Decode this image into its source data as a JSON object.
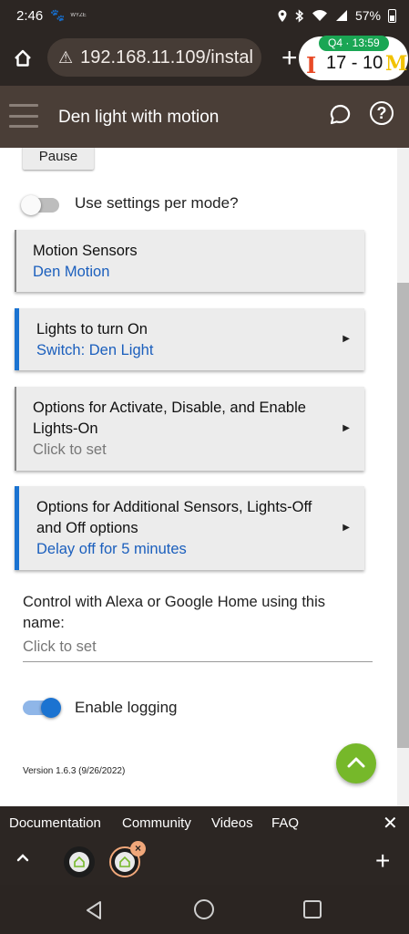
{
  "status_bar": {
    "time": "2:46",
    "paw_glyph": "🐾",
    "app_tag": "WYZE",
    "battery": "57%"
  },
  "browser": {
    "url": "192.168.11.109/instal",
    "warning_glyph": "⚠",
    "new_tab": "+"
  },
  "score": {
    "period": "Q4 · 13:59",
    "team_left": "I",
    "score_text": "17 - 10",
    "team_right": "M"
  },
  "header": {
    "title": "Den light with motion",
    "help_glyph": "?"
  },
  "content": {
    "pause_label": "Pause",
    "settings_per_mode": {
      "label": "Use settings per mode?",
      "enabled": false
    },
    "cards": [
      {
        "title": "Motion Sensors",
        "subtitle": "Den Motion"
      },
      {
        "title": "Lights to turn On",
        "subtitle": "Switch: Den Light"
      },
      {
        "title": "Options for Activate, Disable, and Enable Lights-On",
        "subtitle": "Click to set"
      },
      {
        "title": "Options for Additional Sensors, Lights-Off and Off options",
        "subtitle": "Delay off for 5 minutes"
      }
    ],
    "arrow_glyph": "▶",
    "name_field": {
      "label": "Control with Alexa or Google Home using this name:",
      "value": "Click to set"
    },
    "logging": {
      "label": "Enable logging",
      "enabled": true
    },
    "version": "Version 1.6.3 (9/26/2022)"
  },
  "footer": {
    "links": [
      "Documentation",
      "Community",
      "Videos",
      "FAQ"
    ],
    "close_glyph": "✕"
  },
  "tabs": {
    "close_glyph": "×",
    "add_glyph": "+"
  },
  "colors": {
    "accent": "#1b73d1",
    "header_bg": "#4a3e37",
    "fab": "#76b82a",
    "link_blue": "#1b5fbd"
  }
}
